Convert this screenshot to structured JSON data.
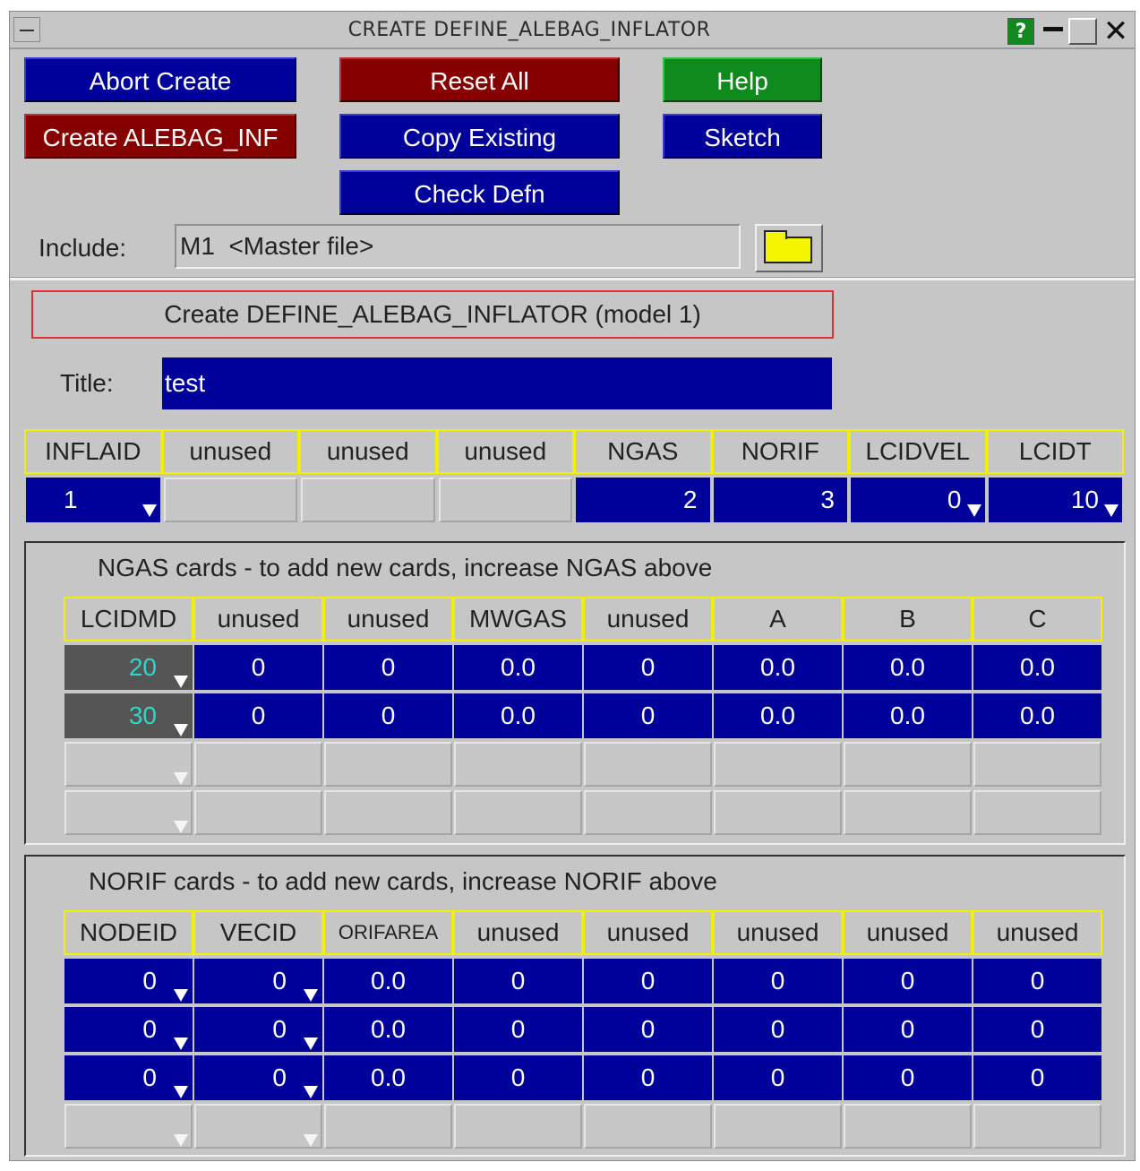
{
  "window": {
    "title": "CREATE DEFINE_ALEBAG_INFLATOR",
    "help_glyph": "?",
    "close_glyph": "✕"
  },
  "buttons": {
    "abort": "Abort Create",
    "create": "Create ALEBAG_INF",
    "reset": "Reset All",
    "copy": "Copy Existing",
    "check": "Check Defn",
    "help": "Help",
    "sketch": "Sketch"
  },
  "include": {
    "label": "Include:",
    "value": "M1  <Master file>"
  },
  "heading": "Create DEFINE_ALEBAG_INFLATOR (model 1)",
  "title_field": {
    "label": "Title:",
    "value": "test"
  },
  "card1": {
    "headers": [
      "INFLAID",
      "unused",
      "unused",
      "unused",
      "NGAS",
      "NORIF",
      "LCIDVEL",
      "LCIDT"
    ],
    "values": [
      "1",
      "",
      "",
      "",
      "2",
      "3",
      "0",
      "10"
    ]
  },
  "ngas_panel": {
    "title": "NGAS cards - to add new cards, increase NGAS above",
    "headers": [
      "LCIDMD",
      "unused",
      "unused",
      "MWGAS",
      "unused",
      "A",
      "B",
      "C"
    ],
    "rows": [
      [
        "20",
        "0",
        "0",
        "0.0",
        "0",
        "0.0",
        "0.0",
        "0.0"
      ],
      [
        "30",
        "0",
        "0",
        "0.0",
        "0",
        "0.0",
        "0.0",
        "0.0"
      ]
    ]
  },
  "norif_panel": {
    "title": "NORIF cards - to add new cards, increase NORIF above",
    "headers": [
      "NODEID",
      "VECID",
      "ORIFAREA",
      "unused",
      "unused",
      "unused",
      "unused",
      "unused"
    ],
    "rows": [
      [
        "0",
        "0",
        "0.0",
        "0",
        "0",
        "0",
        "0",
        "0"
      ],
      [
        "0",
        "0",
        "0.0",
        "0",
        "0",
        "0",
        "0",
        "0"
      ],
      [
        "0",
        "0",
        "0.0",
        "0",
        "0",
        "0",
        "0",
        "0"
      ]
    ]
  },
  "colors": {
    "field_blue": "#00009a",
    "button_red": "#870000",
    "button_green": "#0f8a1d",
    "header_border": "#f0f000",
    "panel_grey": "#c6c6c6"
  }
}
